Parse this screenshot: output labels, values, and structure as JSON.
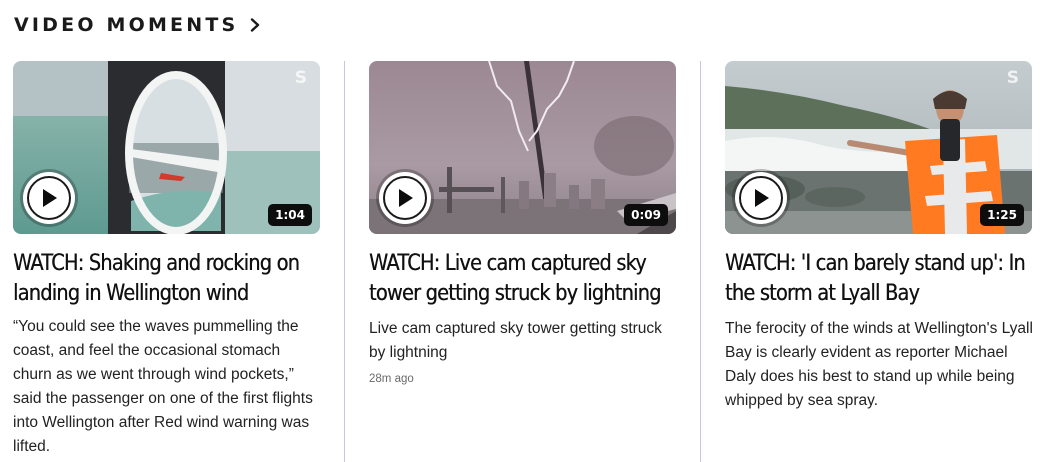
{
  "section": {
    "title": "VIDEO MOMENTS",
    "chevron_icon": "chevron-right-icon"
  },
  "colors": {
    "text": "#1a1a1a",
    "divider": "#c9c9d6",
    "duration_badge_bg": "#0d0d0d",
    "play_button_bg": "#ffffff"
  },
  "cards": [
    {
      "duration": "1:04",
      "headline": "WATCH: Shaking and rocking on landing in Wellington wind",
      "summary": "“You could see the waves pummelling the coast, and feel the occasional stomach churn as we went through wind pockets,” said the passenger on one of the first flights into Wellington after Red wind warning was lifted.",
      "brand_mark": "S",
      "thumbnail": "airplane-window-view"
    },
    {
      "duration": "0:09",
      "headline": "WATCH: Live cam captured sky tower getting struck by lightning",
      "summary": "Live cam captured sky tower getting struck by lightning",
      "timestamp": "28m ago",
      "thumbnail": "lightning-strike-tower"
    },
    {
      "duration": "1:25",
      "headline": "WATCH: 'I can barely stand up': In the storm at Lyall Bay",
      "summary": "The ferocity of the winds at Wellington's Lyall Bay is clearly evident as reporter Michael Daly does his best to stand up while being whipped by sea spray.",
      "brand_mark": "S",
      "thumbnail": "reporter-in-storm"
    }
  ]
}
